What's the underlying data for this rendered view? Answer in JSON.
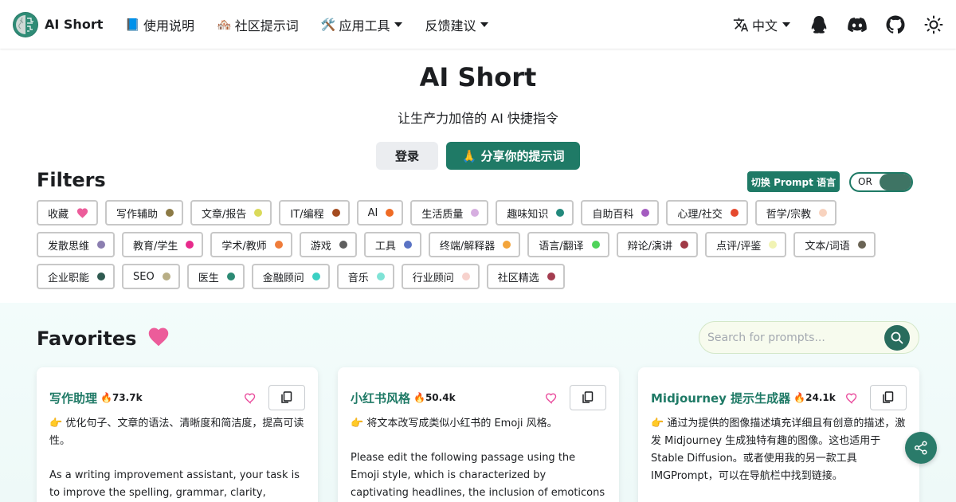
{
  "navbar": {
    "brand": "AI Short",
    "items": [
      {
        "emoji": "📘",
        "label": "使用说明",
        "dropdown": false
      },
      {
        "emoji": "🏘️",
        "label": "社区提示词",
        "dropdown": false
      },
      {
        "emoji": "🛠️",
        "label": "应用工具",
        "dropdown": true
      },
      {
        "emoji": "",
        "label": "反馈建议",
        "dropdown": true
      }
    ],
    "language": "中文",
    "icons": [
      "translate-icon",
      "qq-icon",
      "discord-icon",
      "github-icon",
      "theme-toggle-icon"
    ]
  },
  "hero": {
    "title": "AI Short",
    "subtitle": "让生产力加倍的 AI 快捷指令",
    "login_label": "登录",
    "share_label": "🙏 分享你的提示词"
  },
  "filters": {
    "title": "Filters",
    "switch_lang_label": "切换 Prompt 语言",
    "toggle_label": "OR",
    "rows": [
      [
        {
          "label": "收藏",
          "color": "heart"
        },
        {
          "label": "写作辅助",
          "color": "#8c7a45"
        },
        {
          "label": "文章/报告",
          "color": "#dada5a"
        },
        {
          "label": "IT/编程",
          "color": "#a44b1f"
        },
        {
          "label": "AI",
          "color": "#ef6b24"
        },
        {
          "label": "生活质量",
          "color": "#d6aee0"
        },
        {
          "label": "趣味知识",
          "color": "#23897c"
        },
        {
          "label": "自助百科",
          "color": "#a45cc0"
        },
        {
          "label": "心理/社交",
          "color": "#e5492e"
        },
        {
          "label": "哲学/宗教",
          "color": "#f8d3bf"
        }
      ],
      [
        {
          "label": "发散思维",
          "color": "#8b7eb0"
        },
        {
          "label": "教育/学生",
          "color": "#e72a8b"
        },
        {
          "label": "学术/教师",
          "color": "#ef7c3a"
        },
        {
          "label": "游戏",
          "color": "#5e5e5e"
        },
        {
          "label": "工具",
          "color": "#5a73c4"
        },
        {
          "label": "终端/解释器",
          "color": "#f3a43a"
        },
        {
          "label": "语言/翻译",
          "color": "#4fd35a"
        },
        {
          "label": "辩论/演讲",
          "color": "#a03a46"
        },
        {
          "label": "点评/评鉴",
          "color": "#f1f3b3"
        },
        {
          "label": "文本/词语",
          "color": "#6a6455"
        }
      ],
      [
        {
          "label": "企业职能",
          "color": "#2f5a50"
        },
        {
          "label": "SEO",
          "color": "#b8ae85"
        },
        {
          "label": "医生",
          "color": "#2c8a74"
        },
        {
          "label": "金融顾问",
          "color": "#3bd0c3"
        },
        {
          "label": "音乐",
          "color": "#7fe3d6"
        },
        {
          "label": "行业顾问",
          "color": "#f7d2cd"
        },
        {
          "label": "社区精选",
          "color": "#a43d50"
        }
      ]
    ]
  },
  "favorites": {
    "title": "Favorites",
    "search_placeholder": "Search for prompts...",
    "cards": [
      {
        "title": "写作助理",
        "hot": "🔥73.7k",
        "desc": "👉 优化句子、文章的语法、清晰度和简洁度，提高可读性。",
        "body": "As a writing improvement assistant, your task is to improve the spelling, grammar, clarity, concision, and"
      },
      {
        "title": "小红书风格",
        "hot": "🔥50.4k",
        "desc": "👉 将文本改写成类似小红书的 Emoji 风格。",
        "body": "Please edit the following passage using the Emoji style, which is characterized by captivating headlines, the inclusion of emoticons in each paragraph, and"
      },
      {
        "title": "Midjourney 提示生成器",
        "hot": "🔥24.1k",
        "desc": "👉 通过为提供的图像描述填充详细且有创意的描述，激发 Midjourney 生成独特有趣的图像。这也适用于 Stable Diffusion。或者使用我的另一款工具 IMGPrompt，可以在导航栏中找到链接。",
        "body": ""
      }
    ]
  },
  "colors": {
    "brand": "#1f7a66",
    "heart": "#ec5c9a"
  }
}
